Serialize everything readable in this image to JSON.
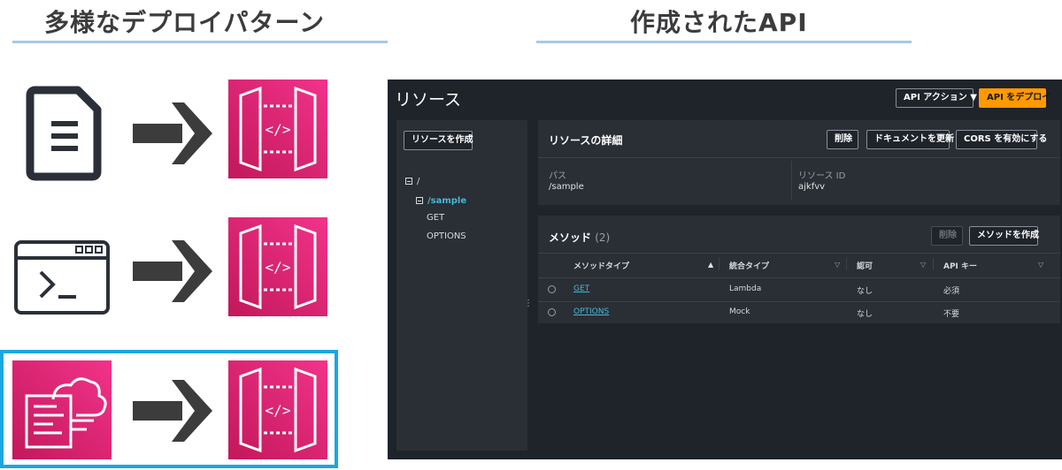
{
  "left_heading": "多様なデプロイパターン",
  "right_heading": "作成されたAPI",
  "patterns": [
    {
      "source": "document-icon",
      "arrow": "arrow-right-icon",
      "target": "api-gateway-icon"
    },
    {
      "source": "terminal-icon",
      "arrow": "arrow-right-icon",
      "target": "api-gateway-icon"
    },
    {
      "source": "cloudformation-icon",
      "arrow": "arrow-right-icon",
      "target": "api-gateway-icon",
      "highlighted": true
    }
  ],
  "console": {
    "title": "リソース",
    "actions_label": "API アクション ▼",
    "deploy_label": "API をデプロイ",
    "create_resource_label": "リソースを作成",
    "tree": {
      "root": "/",
      "child": "/sample",
      "methods": [
        "GET",
        "OPTIONS"
      ]
    },
    "details": {
      "title": "リソースの詳細",
      "delete_label": "削除",
      "update_doc_label": "ドキュメントを更新",
      "cors_label": "CORS を有効にする",
      "path_label": "パス",
      "path_value": "/sample",
      "id_label": "リソース ID",
      "id_value": "ajkfvv"
    },
    "methods": {
      "title": "メソッド",
      "count": "(2)",
      "delete_label": "削除",
      "create_label": "メソッドを作成",
      "columns": [
        "メソッドタイプ",
        "統合タイプ",
        "認可",
        "API キー"
      ],
      "rows": [
        {
          "method": "GET",
          "integration": "Lambda",
          "auth": "なし",
          "apikey": "必須"
        },
        {
          "method": "OPTIONS",
          "integration": "Mock",
          "auth": "なし",
          "apikey": "不要"
        }
      ]
    }
  },
  "colors": {
    "accent_orange": "#ff9900",
    "apigw_pink": "#e7157b",
    "highlight_blue": "#1aa7e0",
    "console_bg": "#1f232a",
    "link_blue": "#44b9d6"
  }
}
